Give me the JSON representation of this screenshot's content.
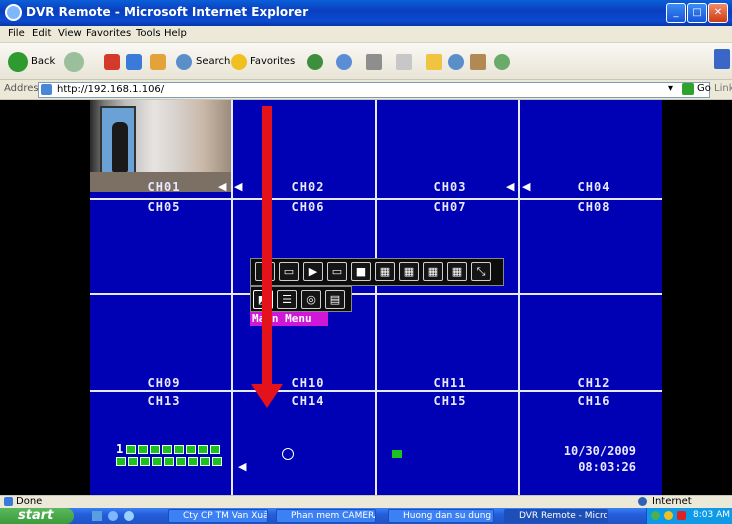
{
  "window": {
    "title": "DVR Remote - Microsoft Internet Explorer"
  },
  "menubar": {
    "items": [
      "File",
      "Edit",
      "View",
      "Favorites",
      "Tools",
      "Help"
    ]
  },
  "toolbar": {
    "back_label": "Back",
    "search_label": "Search",
    "favorites_label": "Favorites"
  },
  "addressbar": {
    "label": "Address",
    "url": "http://192.168.1.106/",
    "go_label": "Go",
    "links_label": "Links"
  },
  "dvr": {
    "channels": [
      "CH01",
      "CH02",
      "CH03",
      "CH04",
      "CH05",
      "CH06",
      "CH07",
      "CH08",
      "CH09",
      "CH10",
      "CH11",
      "CH12",
      "CH13",
      "CH14",
      "CH15",
      "CH16"
    ],
    "main_menu_label": "Main Menu",
    "indicator_start": "1",
    "date": "10/30/2009",
    "time": "08:03:26"
  },
  "status": {
    "left": "Done",
    "zone": "Internet"
  },
  "taskbar": {
    "start_label": "start",
    "tasks": [
      "Cty CP TM Van Xuân ...",
      "Phan mem CAMERA",
      "Huong dan su dung d...",
      "DVR Remote - Micros..."
    ],
    "clock": "8:03 AM"
  },
  "colors": {
    "dvr_background": "#0000b4",
    "annotation_arrow": "#e4121a",
    "menu_highlight": "#d017d8"
  }
}
